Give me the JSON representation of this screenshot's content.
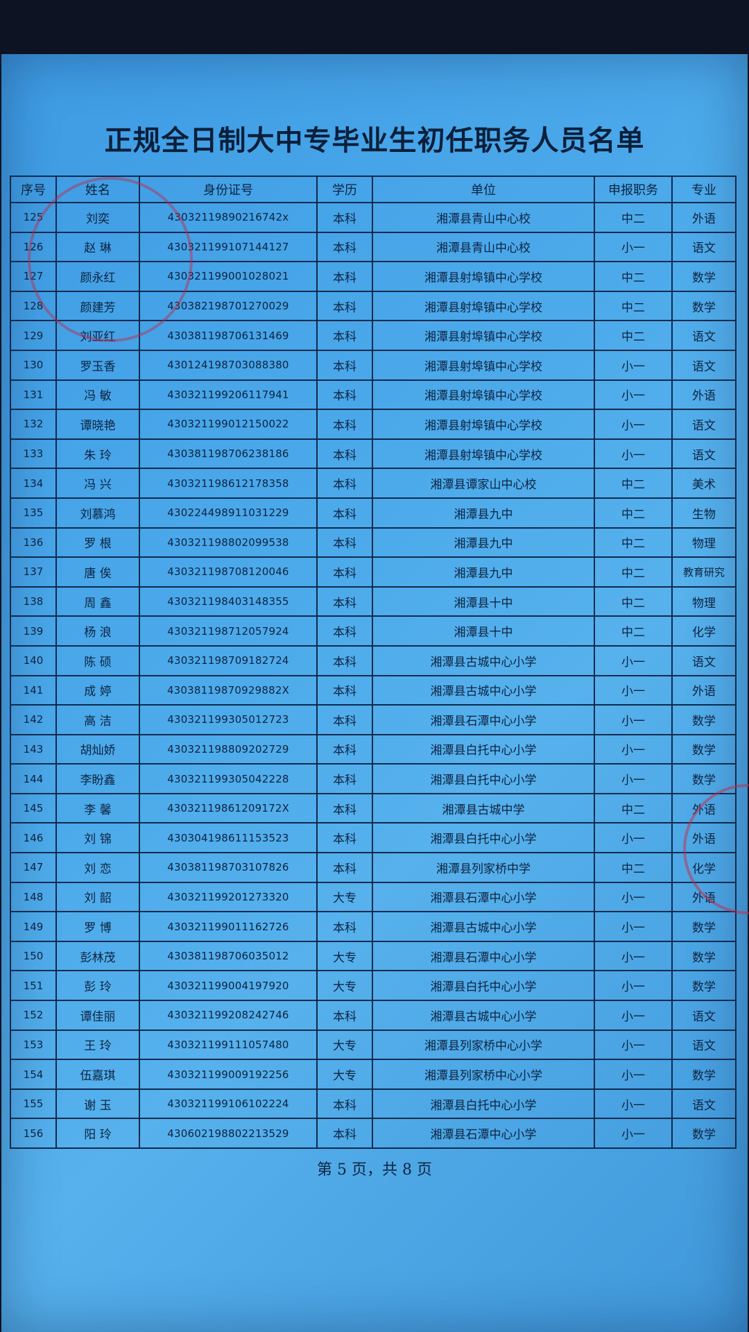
{
  "document": {
    "title": "正规全日制大中专毕业生初任职务人员名单",
    "footer": "第 5 页，共 8 页"
  },
  "table": {
    "headers": {
      "seq": "序号",
      "name": "姓名",
      "id_number": "身份证号",
      "education": "学历",
      "unit": "单位",
      "rank": "申报职务",
      "major": "专业"
    },
    "rows": [
      {
        "seq": "125",
        "name": "刘奕",
        "id_number": "43032119890216742x",
        "education": "本科",
        "unit": "湘潭县青山中心校",
        "rank": "中二",
        "major": "外语"
      },
      {
        "seq": "126",
        "name": "赵 琳",
        "id_number": "430321199107144127",
        "education": "本科",
        "unit": "湘潭县青山中心校",
        "rank": "小一",
        "major": "语文"
      },
      {
        "seq": "127",
        "name": "颜永红",
        "id_number": "430321199001028021",
        "education": "本科",
        "unit": "湘潭县射埠镇中心学校",
        "rank": "中二",
        "major": "数学"
      },
      {
        "seq": "128",
        "name": "颜建芳",
        "id_number": "430382198701270029",
        "education": "本科",
        "unit": "湘潭县射埠镇中心学校",
        "rank": "中二",
        "major": "数学"
      },
      {
        "seq": "129",
        "name": "刘亚红",
        "id_number": "430381198706131469",
        "education": "本科",
        "unit": "湘潭县射埠镇中心学校",
        "rank": "中二",
        "major": "语文"
      },
      {
        "seq": "130",
        "name": "罗玉香",
        "id_number": "430124198703088380",
        "education": "本科",
        "unit": "湘潭县射埠镇中心学校",
        "rank": "小一",
        "major": "语文"
      },
      {
        "seq": "131",
        "name": "冯 敏",
        "id_number": "430321199206117941",
        "education": "本科",
        "unit": "湘潭县射埠镇中心学校",
        "rank": "小一",
        "major": "外语"
      },
      {
        "seq": "132",
        "name": "谭晓艳",
        "id_number": "430321199012150022",
        "education": "本科",
        "unit": "湘潭县射埠镇中心学校",
        "rank": "小一",
        "major": "语文"
      },
      {
        "seq": "133",
        "name": "朱 玲",
        "id_number": "430381198706238186",
        "education": "本科",
        "unit": "湘潭县射埠镇中心学校",
        "rank": "小一",
        "major": "语文"
      },
      {
        "seq": "134",
        "name": "冯 兴",
        "id_number": "430321198612178358",
        "education": "本科",
        "unit": "湘潭县谭家山中心校",
        "rank": "中二",
        "major": "美术"
      },
      {
        "seq": "135",
        "name": "刘慕鸿",
        "id_number": "430224498911031229",
        "education": "本科",
        "unit": "湘潭县九中",
        "rank": "中二",
        "major": "生物"
      },
      {
        "seq": "136",
        "name": "罗 根",
        "id_number": "430321198802099538",
        "education": "本科",
        "unit": "湘潭县九中",
        "rank": "中二",
        "major": "物理"
      },
      {
        "seq": "137",
        "name": "唐 俟",
        "id_number": "430321198708120046",
        "education": "本科",
        "unit": "湘潭县九中",
        "rank": "中二",
        "major": "教育研究"
      },
      {
        "seq": "138",
        "name": "周 鑫",
        "id_number": "430321198403148355",
        "education": "本科",
        "unit": "湘潭县十中",
        "rank": "中二",
        "major": "物理"
      },
      {
        "seq": "139",
        "name": "杨 浪",
        "id_number": "430321198712057924",
        "education": "本科",
        "unit": "湘潭县十中",
        "rank": "中二",
        "major": "化学"
      },
      {
        "seq": "140",
        "name": "陈 硕",
        "id_number": "430321198709182724",
        "education": "本科",
        "unit": "湘潭县古城中心小学",
        "rank": "小一",
        "major": "语文"
      },
      {
        "seq": "141",
        "name": "成 婷",
        "id_number": "43038119870929882X",
        "education": "本科",
        "unit": "湘潭县古城中心小学",
        "rank": "小一",
        "major": "外语"
      },
      {
        "seq": "142",
        "name": "高 洁",
        "id_number": "430321199305012723",
        "education": "本科",
        "unit": "湘潭县石潭中心小学",
        "rank": "小一",
        "major": "数学"
      },
      {
        "seq": "143",
        "name": "胡灿娇",
        "id_number": "430321198809202729",
        "education": "本科",
        "unit": "湘潭县白托中心小学",
        "rank": "小一",
        "major": "数学"
      },
      {
        "seq": "144",
        "name": "李盼鑫",
        "id_number": "430321199305042228",
        "education": "本科",
        "unit": "湘潭县白托中心小学",
        "rank": "小一",
        "major": "数学"
      },
      {
        "seq": "145",
        "name": "李 馨",
        "id_number": "43032119861209172X",
        "education": "本科",
        "unit": "湘潭县古城中学",
        "rank": "中二",
        "major": "外语"
      },
      {
        "seq": "146",
        "name": "刘 锦",
        "id_number": "430304198611153523",
        "education": "本科",
        "unit": "湘潭县白托中心小学",
        "rank": "小一",
        "major": "外语"
      },
      {
        "seq": "147",
        "name": "刘 恋",
        "id_number": "430381198703107826",
        "education": "本科",
        "unit": "湘潭县列家桥中学",
        "rank": "中二",
        "major": "化学"
      },
      {
        "seq": "148",
        "name": "刘 韶",
        "id_number": "430321199201273320",
        "education": "大专",
        "unit": "湘潭县石潭中心小学",
        "rank": "小一",
        "major": "外语"
      },
      {
        "seq": "149",
        "name": "罗 博",
        "id_number": "430321199011162726",
        "education": "本科",
        "unit": "湘潭县古城中心小学",
        "rank": "小一",
        "major": "数学"
      },
      {
        "seq": "150",
        "name": "彭林茂",
        "id_number": "430381198706035012",
        "education": "大专",
        "unit": "湘潭县石潭中心小学",
        "rank": "小一",
        "major": "数学"
      },
      {
        "seq": "151",
        "name": "彭 玲",
        "id_number": "430321199004197920",
        "education": "大专",
        "unit": "湘潭县白托中心小学",
        "rank": "小一",
        "major": "数学"
      },
      {
        "seq": "152",
        "name": "谭佳丽",
        "id_number": "430321199208242746",
        "education": "本科",
        "unit": "湘潭县古城中心小学",
        "rank": "小一",
        "major": "语文"
      },
      {
        "seq": "153",
        "name": "王 玲",
        "id_number": "430321199111057480",
        "education": "大专",
        "unit": "湘潭县列家桥中心小学",
        "rank": "小一",
        "major": "语文"
      },
      {
        "seq": "154",
        "name": "伍嘉琪",
        "id_number": "430321199009192256",
        "education": "大专",
        "unit": "湘潭县列家桥中心小学",
        "rank": "小一",
        "major": "数学"
      },
      {
        "seq": "155",
        "name": "谢 玉",
        "id_number": "430321199106102224",
        "education": "本科",
        "unit": "湘潭县白托中心小学",
        "rank": "小一",
        "major": "语文"
      },
      {
        "seq": "156",
        "name": "阳 玲",
        "id_number": "430602198802213529",
        "education": "本科",
        "unit": "湘潭县石潭中心小学",
        "rank": "小一",
        "major": "数学"
      }
    ]
  },
  "colors": {
    "paper": "#4aa8ea",
    "ink": "#0e2340",
    "grid": "#0f2a4e",
    "seal": "#c8283c",
    "background": "#0d1322"
  }
}
